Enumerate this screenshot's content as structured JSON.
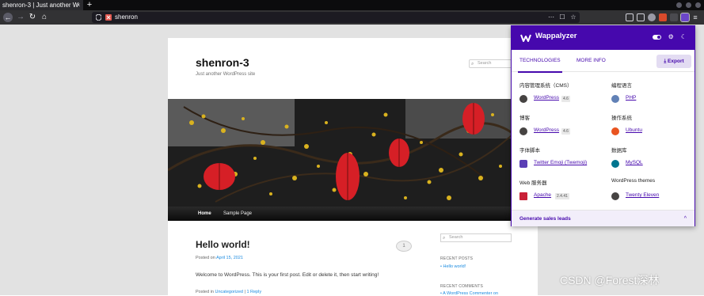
{
  "browser": {
    "tab_title": "shenron-3 | Just another W",
    "tab_close": "×",
    "new_tab": "+",
    "url": "shenron",
    "url_tools": [
      "⋯",
      "☐",
      "☆"
    ]
  },
  "site": {
    "title": "shenron-3",
    "description": "Just another WordPress site",
    "search_placeholder": "Search",
    "nav": {
      "home": "Home",
      "sample": "Sample Page"
    },
    "post": {
      "title": "Hello world!",
      "posted_on": "Posted on",
      "date": "April 15, 2021",
      "body": "Welcome to WordPress. This is your first post. Edit or delete it, then start writing!",
      "posted_in": "Posted in",
      "category": "Uncategorized",
      "separator": " | ",
      "reply": "1 Reply",
      "comment_count": "1"
    },
    "sidebar": {
      "search_placeholder": "Search",
      "recent_posts_heading": "RECENT POSTS",
      "recent_post": "Hello world!",
      "recent_comments_heading": "RECENT COMMENTS",
      "recent_comment": "A WordPress Commenter on"
    }
  },
  "wappalyzer": {
    "name": "Wappalyzer",
    "tabs": {
      "technologies": "TECHNOLOGIES",
      "more_info": "MORE INFO"
    },
    "export": "Export",
    "categories": [
      {
        "name": "内容管理系统（CMS）",
        "tech": "WordPress",
        "version": "4.6",
        "icon_color": "#464342"
      },
      {
        "name": "编程语言",
        "tech": "PHP",
        "version": "",
        "icon_color": "#6181b6"
      },
      {
        "name": "博客",
        "tech": "WordPress",
        "version": "4.6",
        "icon_color": "#464342"
      },
      {
        "name": "操作系统",
        "tech": "Ubuntu",
        "version": "",
        "icon_color": "#e95420"
      },
      {
        "name": "字体脚本",
        "tech": "Twitter Emoji (Twemoji)",
        "version": "",
        "icon_color": "#5b3fb5"
      },
      {
        "name": "数据库",
        "tech": "MySQL",
        "version": "",
        "icon_color": "#00758f"
      },
      {
        "name": "Web 服务器",
        "tech": "Apache",
        "version": "2.4.41",
        "icon_color": "#c92037"
      },
      {
        "name": "WordPress themes",
        "tech": "Twenty Eleven",
        "version": "",
        "icon_color": "#464342"
      }
    ],
    "footer": "Generate sales leads",
    "footer_caret": "^"
  },
  "watermark": "CSDN @Forest深林"
}
